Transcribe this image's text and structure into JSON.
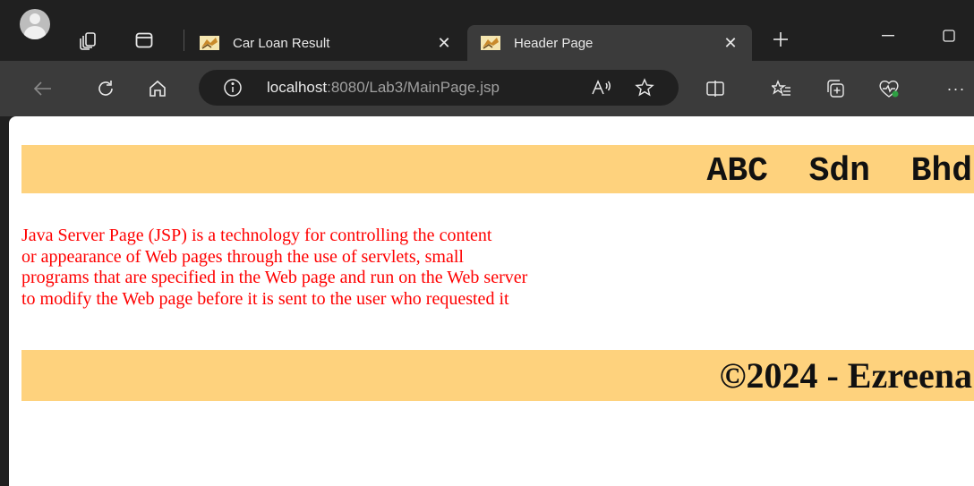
{
  "tabs": [
    {
      "title": "Car Loan Result",
      "active": false
    },
    {
      "title": "Header Page",
      "active": true
    }
  ],
  "address_bar": {
    "host": "localhost",
    "rest": ":8080/Lab3/MainPage.jsp"
  },
  "page": {
    "company": "ABC  Sdn  Bhd",
    "description_lines": [
      "Java Server Page (JSP) is a technology for controlling the content",
      "or appearance of Web pages through the use of servlets, small",
      "programs that are specified in the Web page and run on the Web server",
      "to modify the Web page before it is sent to the user who requested it"
    ],
    "footer": "©2024 - Ezreena"
  },
  "colors": {
    "band": "#fed27d",
    "description": "#ff0000",
    "chrome_dark": "#202020",
    "chrome_mid": "#3b3b3b"
  }
}
